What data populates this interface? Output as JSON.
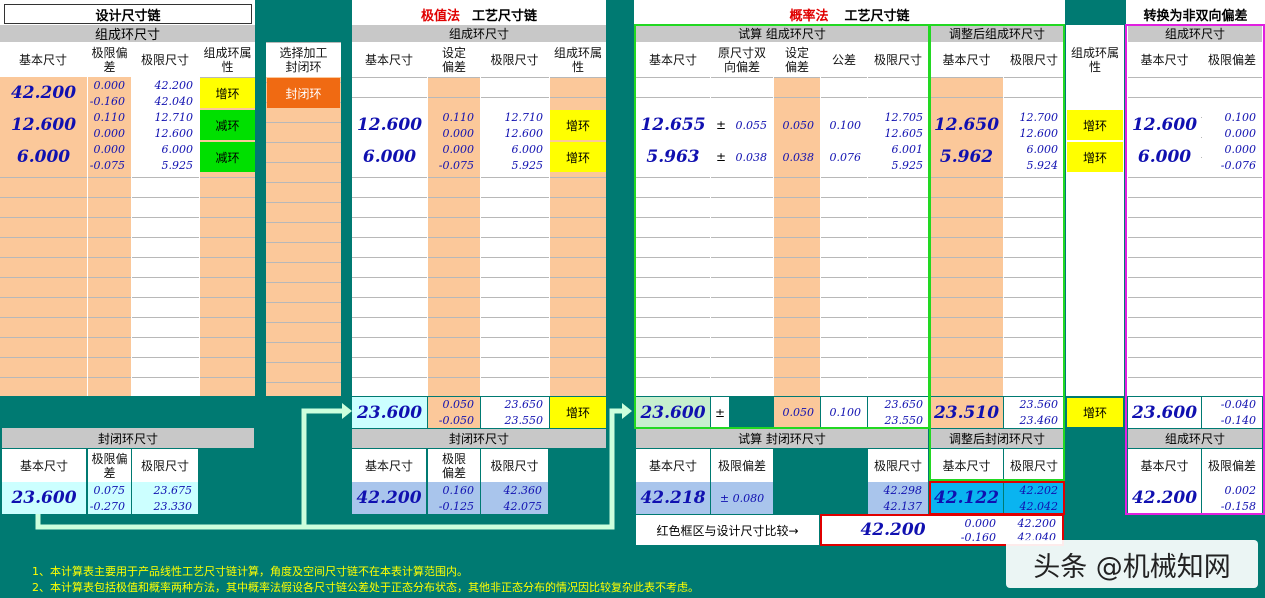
{
  "design": {
    "title": "设计尺寸链",
    "comp_header": "组成环尺寸",
    "col_basic": "基本尺寸",
    "col_dev": "极限偏差",
    "col_lim": "极限尺寸",
    "col_attr": "组成环属性",
    "rows": [
      {
        "basic": "42.200",
        "dev_up": "0.000",
        "dev_lo": "-0.160",
        "lim_up": "42.200",
        "lim_lo": "42.040",
        "attr": "增环"
      },
      {
        "basic": "12.600",
        "dev_up": "0.110",
        "dev_lo": "0.000",
        "lim_up": "12.710",
        "lim_lo": "12.600",
        "attr": "减环"
      },
      {
        "basic": "6.000",
        "dev_up": "0.000",
        "dev_lo": "-0.075",
        "lim_up": "6.000",
        "lim_lo": "5.925",
        "attr": "减环"
      }
    ],
    "closing_header": "封闭环尺寸",
    "closing": {
      "basic": "23.600",
      "dev_up": "0.075",
      "dev_lo": "-0.270",
      "lim_up": "23.675",
      "lim_lo": "23.330"
    }
  },
  "select": {
    "header": "选择加工封闭环",
    "value": "封闭环"
  },
  "extreme": {
    "title_red": "极值法",
    "title": "工艺尺寸链",
    "comp_header": "组成环尺寸",
    "col_basic": "基本尺寸",
    "col_dev": "设定偏差",
    "col_lim": "极限尺寸",
    "col_attr": "组成环属性",
    "rows": [
      {
        "basic": "12.600",
        "dev_up": "0.110",
        "dev_lo": "0.000",
        "lim_up": "12.710",
        "lim_lo": "12.600",
        "attr": "增环"
      },
      {
        "basic": "6.000",
        "dev_up": "0.000",
        "dev_lo": "-0.075",
        "lim_up": "6.000",
        "lim_lo": "5.925",
        "attr": "增环"
      }
    ],
    "bottom": {
      "basic": "23.600",
      "dev_up": "0.050",
      "dev_lo": "-0.050",
      "lim_up": "23.650",
      "lim_lo": "23.550",
      "attr": "增环"
    },
    "closing_header": "封闭环尺寸",
    "col_dev2": "极限偏差",
    "closing": {
      "basic": "42.200",
      "dev_up": "0.160",
      "dev_lo": "-0.125",
      "lim_up": "42.360",
      "lim_lo": "42.075"
    }
  },
  "prob": {
    "title_red": "概率法",
    "title": "工艺尺寸链",
    "trial_header": "试算 组成环尺寸",
    "adj_header": "调整后组成环尺寸",
    "col_basic": "基本尺寸",
    "col_orig": "原尺寸双向偏差",
    "col_set": "设定偏差",
    "col_tol": "公差",
    "col_lim": "极限尺寸",
    "col_attr": "组成环属性",
    "pm": "±",
    "rows": [
      {
        "basic": "12.655",
        "orig": "0.055",
        "set": "0.050",
        "tol": "0.100",
        "lim_up": "12.705",
        "lim_lo": "12.605",
        "adj_basic": "12.650",
        "adj_up": "12.700",
        "adj_lo": "12.600",
        "attr": "增环"
      },
      {
        "basic": "5.963",
        "orig": "0.038",
        "set": "0.038",
        "tol": "0.076",
        "lim_up": "6.001",
        "lim_lo": "5.925",
        "adj_basic": "5.962",
        "adj_up": "6.000",
        "adj_lo": "5.924",
        "attr": "增环"
      }
    ],
    "bottom": {
      "basic": "23.600",
      "set": "0.050",
      "tol": "0.100",
      "lim_up": "23.650",
      "lim_lo": "23.550",
      "adj_basic": "23.510",
      "adj_up": "23.560",
      "adj_lo": "23.460",
      "attr": "增环"
    },
    "trial_closing_header": "试算 封闭环尺寸",
    "adj_closing_header": "调整后封闭环尺寸",
    "col_dev": "极限偏差",
    "trial_closing": {
      "basic": "42.218",
      "dev": "± 0.080",
      "lim_up": "42.298",
      "lim_lo": "42.137"
    },
    "adj_closing": {
      "basic": "42.122",
      "lim_up": "42.202",
      "lim_lo": "42.042"
    },
    "compare_label": "红色框区与设计尺寸比较→",
    "compare": {
      "basic": "42.200",
      "dev_up": "0.000",
      "dev_lo": "-0.160",
      "lim_up": "42.200",
      "lim_lo": "42.040"
    }
  },
  "convert": {
    "title": "转换为非双向偏差",
    "comp_header": "组成环尺寸",
    "col_basic": "基本尺寸",
    "col_dev": "极限偏差",
    "rows": [
      {
        "basic": "12.600",
        "up": "0.100",
        "lo": "0.000"
      },
      {
        "basic": "6.000",
        "up": "0.000",
        "lo": "-0.076"
      }
    ],
    "bottom": {
      "basic": "23.600",
      "up": "-0.040",
      "lo": "-0.140"
    },
    "closing_header": "组成环尺寸",
    "closing": {
      "basic": "42.200",
      "up": "0.002",
      "lo": "-0.158"
    }
  },
  "notes": [
    "1、本计算表主要用于产品线性工艺尺寸链计算，角度及空间尺寸链不在本表计算范围内。",
    "2、本计算表包括极值和概率两种方法，其中概率法假设各尺寸链公差处于正态分布状态，其他非正态分布的情况因比较复杂此表不考虑。"
  ],
  "watermark": "头条 @机械知网"
}
